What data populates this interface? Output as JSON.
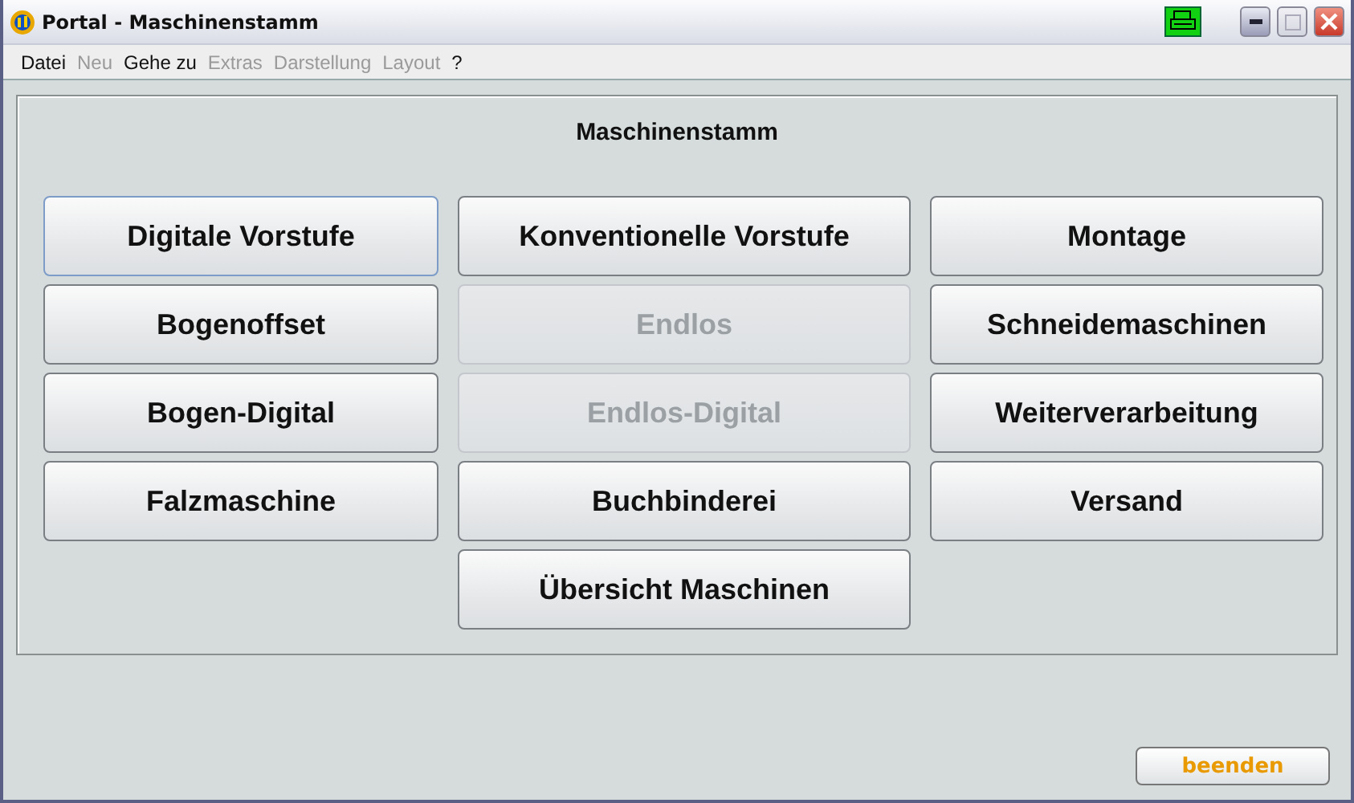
{
  "window": {
    "title": "Portal - Maschinenstamm"
  },
  "menu": [
    {
      "label": "Datei",
      "disabled": false
    },
    {
      "label": "Neu",
      "disabled": true
    },
    {
      "label": "Gehe zu",
      "disabled": false
    },
    {
      "label": "Extras",
      "disabled": true
    },
    {
      "label": "Darstellung",
      "disabled": true
    },
    {
      "label": "Layout",
      "disabled": true
    },
    {
      "label": "?",
      "disabled": false
    }
  ],
  "panel": {
    "title": "Maschinenstamm",
    "columns": [
      [
        {
          "label": "Digitale Vorstufe",
          "disabled": false,
          "focused": true
        },
        {
          "label": "Bogenoffset",
          "disabled": false,
          "focused": false
        },
        {
          "label": "Bogen-Digital",
          "disabled": false,
          "focused": false
        },
        {
          "label": "Falzmaschine",
          "disabled": false,
          "focused": false
        }
      ],
      [
        {
          "label": "Konventionelle Vorstufe",
          "disabled": false,
          "focused": false
        },
        {
          "label": "Endlos",
          "disabled": true,
          "focused": false
        },
        {
          "label": "Endlos-Digital",
          "disabled": true,
          "focused": false
        },
        {
          "label": "Buchbinderei",
          "disabled": false,
          "focused": false
        },
        {
          "label": "Übersicht Maschinen",
          "disabled": false,
          "focused": false
        }
      ],
      [
        {
          "label": "Montage",
          "disabled": false,
          "focused": false
        },
        {
          "label": "Schneidemaschinen",
          "disabled": false,
          "focused": false
        },
        {
          "label": "Weiterverarbeitung",
          "disabled": false,
          "focused": false
        },
        {
          "label": "Versand",
          "disabled": false,
          "focused": false
        }
      ]
    ]
  },
  "footer": {
    "button": "beenden"
  }
}
